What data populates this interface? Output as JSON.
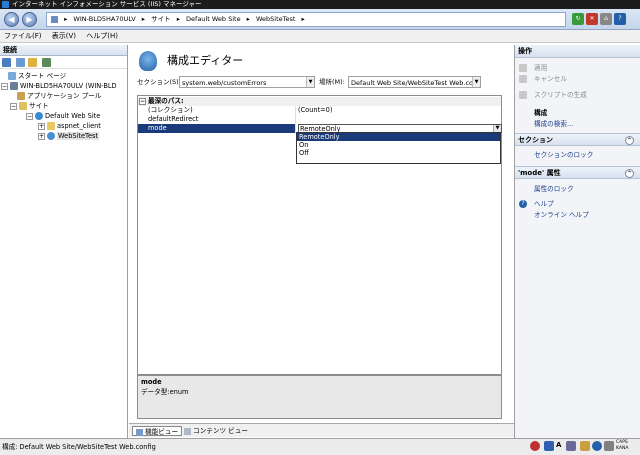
{
  "window": {
    "title": "インターネット インフォメーション サービス (IIS) マネージャー"
  },
  "address": {
    "segments": [
      "WIN-BLD5HA70ULV",
      "サイト",
      "Default Web Site",
      "WebSiteTest"
    ],
    "separator": "▸"
  },
  "menu": [
    "ファイル(F)",
    "表示(V)",
    "ヘルプ(H)"
  ],
  "connections": {
    "header": "接続",
    "tree": [
      {
        "label": "スタート ページ",
        "icon": "start-page-icon"
      },
      {
        "label": "WIN-BLD5HA70ULV (WIN-BLD",
        "icon": "server-icon",
        "expander": "−"
      },
      {
        "label": "アプリケーション プール",
        "icon": "app-pool-icon"
      },
      {
        "label": "サイト",
        "icon": "sites-folder-icon",
        "expander": "−"
      },
      {
        "label": "Default Web Site",
        "icon": "globe-icon",
        "expander": "−"
      },
      {
        "label": "aspnet_client",
        "icon": "folder-icon",
        "expander": "+"
      },
      {
        "label": "WebSiteTest",
        "icon": "web-app-icon",
        "expander": "+"
      }
    ]
  },
  "editor": {
    "title": "構成エディター",
    "section_label": "セクション(S):",
    "section_value": "system.web/customErrors",
    "location_label": "場所(M):",
    "location_value": "Default Web Site/WebSiteTest Web.co",
    "group_header": "最深のパス:",
    "rows": [
      {
        "name": "(コレクション)",
        "value": "(Count=0)"
      },
      {
        "name": "defaultRedirect",
        "value": ""
      },
      {
        "name": "mode",
        "value": "RemoteOnly"
      }
    ],
    "dropdown_options": [
      "RemoteOnly",
      "On",
      "Off"
    ],
    "selected_option": "RemoteOnly",
    "description_title": "mode",
    "description_text": "データ型:enum",
    "view_tabs": [
      "機能ビュー",
      "コンテンツ ビュー"
    ]
  },
  "actions": {
    "header": "操作",
    "items": [
      {
        "label": "適用",
        "enabled": false,
        "icon": "apply-icon"
      },
      {
        "label": "キャンセル",
        "enabled": false,
        "icon": "cancel-icon"
      },
      {
        "label": "スクリプトの生成",
        "enabled": false,
        "icon": "script-icon"
      },
      {
        "label": "構成",
        "enabled": true,
        "bold": true
      },
      {
        "label": "構成の検索...",
        "enabled": true
      }
    ],
    "section_header": "セクション",
    "section_items": [
      "セクションのロック"
    ],
    "attr_header": "'mode' 属性",
    "attr_items": [
      "属性のロック"
    ],
    "help_items": [
      "ヘルプ",
      "オンライン ヘルプ"
    ]
  },
  "status": {
    "text": "構成: Default Web Site/WebSiteTest Web.config",
    "ime": "CAPS KANA"
  },
  "colors": {
    "selection": "#1a3a7a",
    "accent": "#2460a8"
  }
}
